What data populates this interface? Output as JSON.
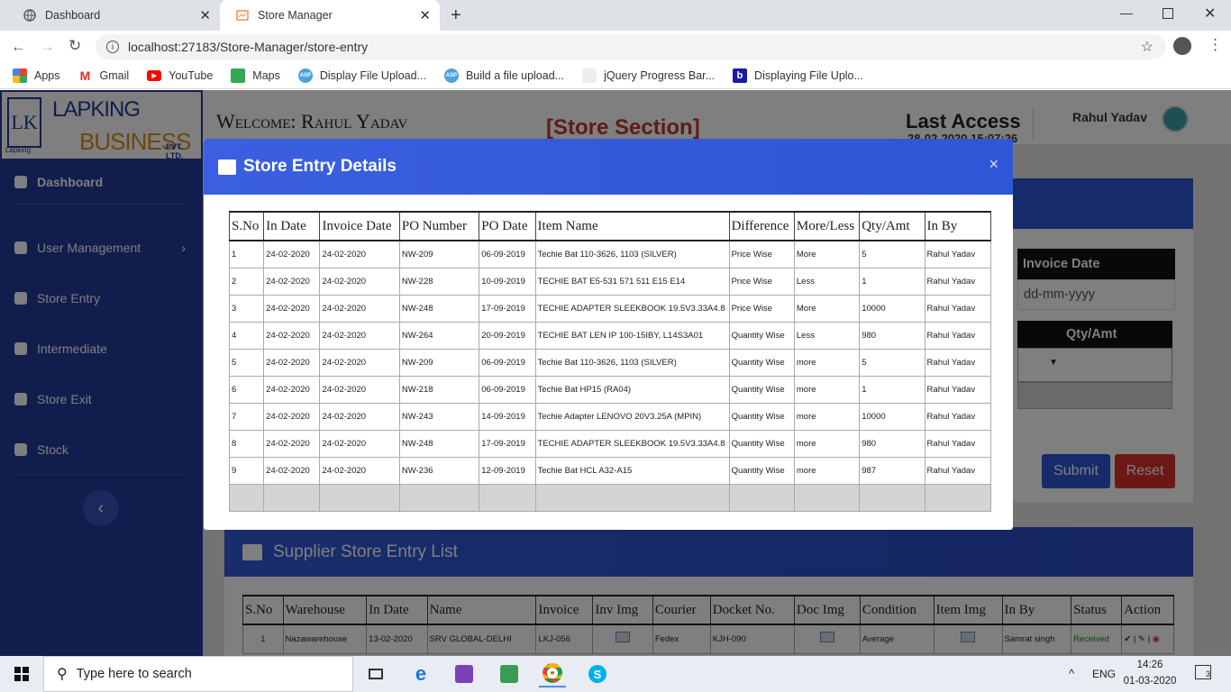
{
  "browser": {
    "tabs": [
      {
        "label": "Dashboard",
        "active": false
      },
      {
        "label": "Store Manager",
        "active": true
      }
    ],
    "url": "localhost:27183/Store-Manager/store-entry",
    "bookmarks": [
      "Apps",
      "Gmail",
      "YouTube",
      "Maps",
      "Display File Upload...",
      "Build a file upload...",
      "jQuery Progress Bar...",
      "Displaying File Uplo..."
    ]
  },
  "logo": {
    "line1": "LAPKING",
    "line2": "BUSINESS",
    "suffix": "PVT. LTD.",
    "mark_text": "Lapking"
  },
  "header": {
    "welcome": "Welcome: Rahul Yadav",
    "section": "[Store Section]",
    "last_access_label": "Last Access",
    "last_access_value": "28-02-2020 15:07:26",
    "user": "Rahul Yadav"
  },
  "sidebar": {
    "items": [
      {
        "label": "Dashboard",
        "bold": true
      },
      {
        "label": "User Management",
        "has_chevron": true
      },
      {
        "label": "Store Entry"
      },
      {
        "label": "Intermediate"
      },
      {
        "label": "Store Exit"
      },
      {
        "label": "Stock"
      }
    ],
    "collapse_symbol": "‹"
  },
  "background_form": {
    "invoice_date_label": "Invoice Date",
    "invoice_date_placeholder": "dd-mm-yyyy",
    "qty_label": "Qty/Amt",
    "submit": "Submit",
    "reset": "Reset"
  },
  "modal": {
    "title": "Store Entry Details",
    "close": "×",
    "columns": [
      "S.No",
      "In Date",
      "Invoice Date",
      "PO Number",
      "PO Date",
      "Item Name",
      "Difference",
      "More/Less",
      "Qty/Amt",
      "In By"
    ],
    "rows": [
      [
        "1",
        "24-02-2020",
        "24-02-2020",
        "NW-209",
        "06-09-2019",
        "Techie Bat 110-3626, 1103 (SILVER)",
        "Price Wise",
        "More",
        "5",
        "Rahul Yadav"
      ],
      [
        "2",
        "24-02-2020",
        "24-02-2020",
        "NW-228",
        "10-09-2019",
        "TECHIE BAT E5-531 571 511 E15 E14",
        "Price Wise",
        "Less",
        "1",
        "Rahul Yadav"
      ],
      [
        "3",
        "24-02-2020",
        "24-02-2020",
        "NW-248",
        "17-09-2019",
        "TECHIE ADAPTER SLEEKBOOK 19.5V3.33A4.8",
        "Price Wise",
        "More",
        "10000",
        "Rahul Yadav"
      ],
      [
        "4",
        "24-02-2020",
        "24-02-2020",
        "NW-264",
        "20-09-2019",
        "TECHIE BAT LEN IP 100-15IBY, L14S3A01",
        "Quantity Wise",
        "Less",
        "980",
        "Rahul Yadav"
      ],
      [
        "5",
        "24-02-2020",
        "24-02-2020",
        "NW-209",
        "06-09-2019",
        "Techie Bat 110-3626, 1103 (SILVER)",
        "Quantity Wise",
        "more",
        "5",
        "Rahul Yadav"
      ],
      [
        "6",
        "24-02-2020",
        "24-02-2020",
        "NW-218",
        "06-09-2019",
        "Techie Bat HP15 (RA04)",
        "Quantity Wise",
        "more",
        "1",
        "Rahul Yadav"
      ],
      [
        "7",
        "24-02-2020",
        "24-02-2020",
        "NW-243",
        "14-09-2019",
        "Techie Adapter LENOVO 20V3.25A (MPIN)",
        "Quantity Wise",
        "more",
        "10000",
        "Rahul Yadav"
      ],
      [
        "8",
        "24-02-2020",
        "24-02-2020",
        "NW-248",
        "17-09-2019",
        "TECHIE ADAPTER SLEEKBOOK 19.5V3.33A4.8",
        "Quantity Wise",
        "more",
        "980",
        "Rahul Yadav"
      ],
      [
        "9",
        "24-02-2020",
        "24-02-2020",
        "NW-236",
        "12-09-2019",
        "Techie Bat HCL A32-A15",
        "Quantity Wise",
        "more",
        "987",
        "Rahul Yadav"
      ]
    ]
  },
  "supplier_list": {
    "title": "Supplier Store Entry List",
    "columns": [
      "S.No",
      "Warehouse",
      "In Date",
      "Name",
      "Invoice",
      "Inv Img",
      "Courier",
      "Docket No.",
      "Doc Img",
      "Condition",
      "Item Img",
      "In By",
      "Status",
      "Action"
    ],
    "rows": [
      {
        "sno": "1",
        "warehouse": "Nazawarehouse",
        "in_date": "13-02-2020",
        "name": "SRV GLOBAL-DELHI",
        "invoice": "LKJ-056",
        "courier": "Fedex",
        "docket": "KJH-090",
        "condition": "Average",
        "in_by": "Samrat singh",
        "status": "Received"
      }
    ]
  },
  "taskbar": {
    "search_placeholder": "Type here to search",
    "lang": "ENG",
    "time": "14:26",
    "date": "01-03-2020",
    "notifications": "3"
  },
  "colors": {
    "sidebar": "#233b99",
    "modal_header": "#3b5fe0",
    "section_red": "#c0392b",
    "status_green": "#1a8a1a"
  }
}
